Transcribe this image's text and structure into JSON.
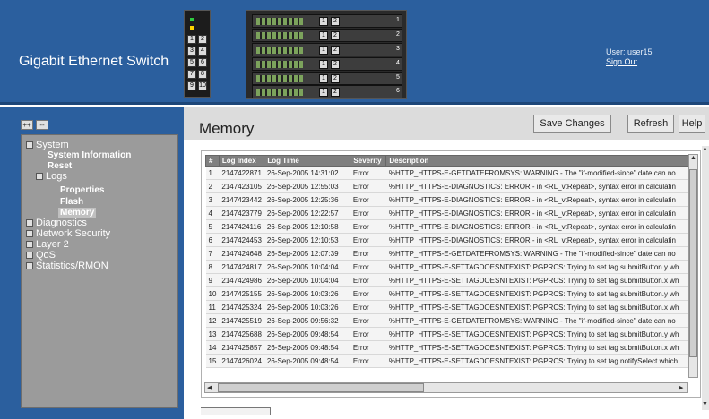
{
  "header": {
    "title": "Gigabit Ethernet Switch",
    "user_label": "User: user15",
    "sign_out": "Sign Out",
    "unit_numbers": [
      "1",
      "2",
      "3",
      "4",
      "5",
      "6"
    ],
    "unit_buttons": [
      "1",
      "2"
    ],
    "left_buttons": [
      "1",
      "2",
      "3",
      "4",
      "5",
      "6",
      "7",
      "8",
      "9",
      "10"
    ]
  },
  "sidebar": {
    "expand_all": "++",
    "collapse_all": "--",
    "items": [
      {
        "label": "System"
      },
      {
        "label": "System Information"
      },
      {
        "label": "Reset"
      },
      {
        "label": "Logs"
      },
      {
        "label": "Properties"
      },
      {
        "label": "Flash"
      },
      {
        "label": "Memory"
      },
      {
        "label": "Diagnostics"
      },
      {
        "label": "Network Security"
      },
      {
        "label": "Layer 2"
      },
      {
        "label": "QoS"
      },
      {
        "label": "Statistics/RMON"
      }
    ]
  },
  "main": {
    "page_title": "Memory",
    "buttons": {
      "save": "Save Changes",
      "refresh": "Refresh",
      "help": "Help"
    },
    "table": {
      "columns": [
        "#",
        "Log Index",
        "Log Time",
        "Severity",
        "Description"
      ],
      "rows": [
        [
          "1",
          "2147422871",
          "26-Sep-2005 14:31:02",
          "Error",
          "%HTTP_HTTPS-E-GETDATEFROMSYS: WARNING - The \"if-modified-since\" date can no"
        ],
        [
          "2",
          "2147423105",
          "26-Sep-2005 12:55:03",
          "Error",
          "%HTTP_HTTPS-E-DIAGNOSTICS: ERROR - in <RL_vtRepeat>, syntax error in calculatin"
        ],
        [
          "3",
          "2147423442",
          "26-Sep-2005 12:25:36",
          "Error",
          "%HTTP_HTTPS-E-DIAGNOSTICS: ERROR - in <RL_vtRepeat>, syntax error in calculatin"
        ],
        [
          "4",
          "2147423779",
          "26-Sep-2005 12:22:57",
          "Error",
          "%HTTP_HTTPS-E-DIAGNOSTICS: ERROR - in <RL_vtRepeat>, syntax error in calculatin"
        ],
        [
          "5",
          "2147424116",
          "26-Sep-2005 12:10:58",
          "Error",
          "%HTTP_HTTPS-E-DIAGNOSTICS: ERROR - in <RL_vtRepeat>, syntax error in calculatin"
        ],
        [
          "6",
          "2147424453",
          "26-Sep-2005 12:10:53",
          "Error",
          "%HTTP_HTTPS-E-DIAGNOSTICS: ERROR - in <RL_vtRepeat>, syntax error in calculatin"
        ],
        [
          "7",
          "2147424648",
          "26-Sep-2005 12:07:39",
          "Error",
          "%HTTP_HTTPS-E-GETDATEFROMSYS: WARNING - The \"if-modified-since\" date can no"
        ],
        [
          "8",
          "2147424817",
          "26-Sep-2005 10:04:04",
          "Error",
          "%HTTP_HTTPS-E-SETTAGDOESNTEXIST: PGPRCS: Trying to set tag submitButton.y wh"
        ],
        [
          "9",
          "2147424986",
          "26-Sep-2005 10:04:04",
          "Error",
          "%HTTP_HTTPS-E-SETTAGDOESNTEXIST: PGPRCS: Trying to set tag submitButton.x wh"
        ],
        [
          "10",
          "2147425155",
          "26-Sep-2005 10:03:26",
          "Error",
          "%HTTP_HTTPS-E-SETTAGDOESNTEXIST: PGPRCS: Trying to set tag submitButton.y wh"
        ],
        [
          "11",
          "2147425324",
          "26-Sep-2005 10:03:26",
          "Error",
          "%HTTP_HTTPS-E-SETTAGDOESNTEXIST: PGPRCS: Trying to set tag submitButton.x wh"
        ],
        [
          "12",
          "2147425519",
          "26-Sep-2005 09:56:32",
          "Error",
          "%HTTP_HTTPS-E-GETDATEFROMSYS: WARNING - The \"if-modified-since\" date can no"
        ],
        [
          "13",
          "2147425688",
          "26-Sep-2005 09:48:54",
          "Error",
          "%HTTP_HTTPS-E-SETTAGDOESNTEXIST: PGPRCS: Trying to set tag submitButton.y wh"
        ],
        [
          "14",
          "2147425857",
          "26-Sep-2005 09:48:54",
          "Error",
          "%HTTP_HTTPS-E-SETTAGDOESNTEXIST: PGPRCS: Trying to set tag submitButton.x wh"
        ],
        [
          "15",
          "2147426024",
          "26-Sep-2005 09:48:54",
          "Error",
          "%HTTP_HTTPS-E-SETTAGDOESNTEXIST: PGPRCS: Trying to set tag notifySelect which"
        ]
      ]
    }
  },
  "colors": {
    "header_blue": "#2b5f9e",
    "nav_gray": "#9b9b9b",
    "table_header": "#7f7f7f"
  },
  "icons": {
    "expand": "plus-box-icon",
    "collapse": "minus-box-icon",
    "scroll_up": "arrow-up-icon",
    "scroll_down": "arrow-down-icon",
    "scroll_left": "arrow-left-icon",
    "scroll_right": "arrow-right-icon"
  }
}
